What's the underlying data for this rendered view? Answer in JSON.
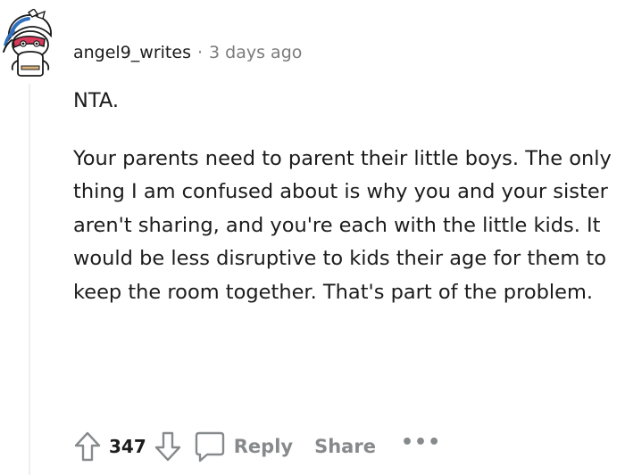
{
  "comment": {
    "author": "angel9_writes",
    "separator": "·",
    "timestamp": "3 days ago",
    "paragraphs": [
      "NTA.",
      "Your parents need to parent their little boys. The only thing I am confused about is why you and your sister aren't sharing, and you're each with the little kids. It would be less disruptive to kids their age for them to keep the room together. That's part of the problem."
    ],
    "score": "347",
    "actions": {
      "reply": "Reply",
      "share": "Share",
      "more": "•••"
    }
  },
  "icons": {
    "avatar": "snoo-avatar-icon",
    "upvote": "upvote-arrow-icon",
    "downvote": "downvote-arrow-icon",
    "reply": "comment-bubble-icon",
    "more": "ellipsis-icon"
  },
  "colors": {
    "text": "#1c1c1c",
    "meta": "#7c7c7c",
    "action": "#878a8c",
    "thread_line": "#edeff1",
    "avatar_accent": "#d93a5b",
    "avatar_blue": "#2f6fbf"
  }
}
